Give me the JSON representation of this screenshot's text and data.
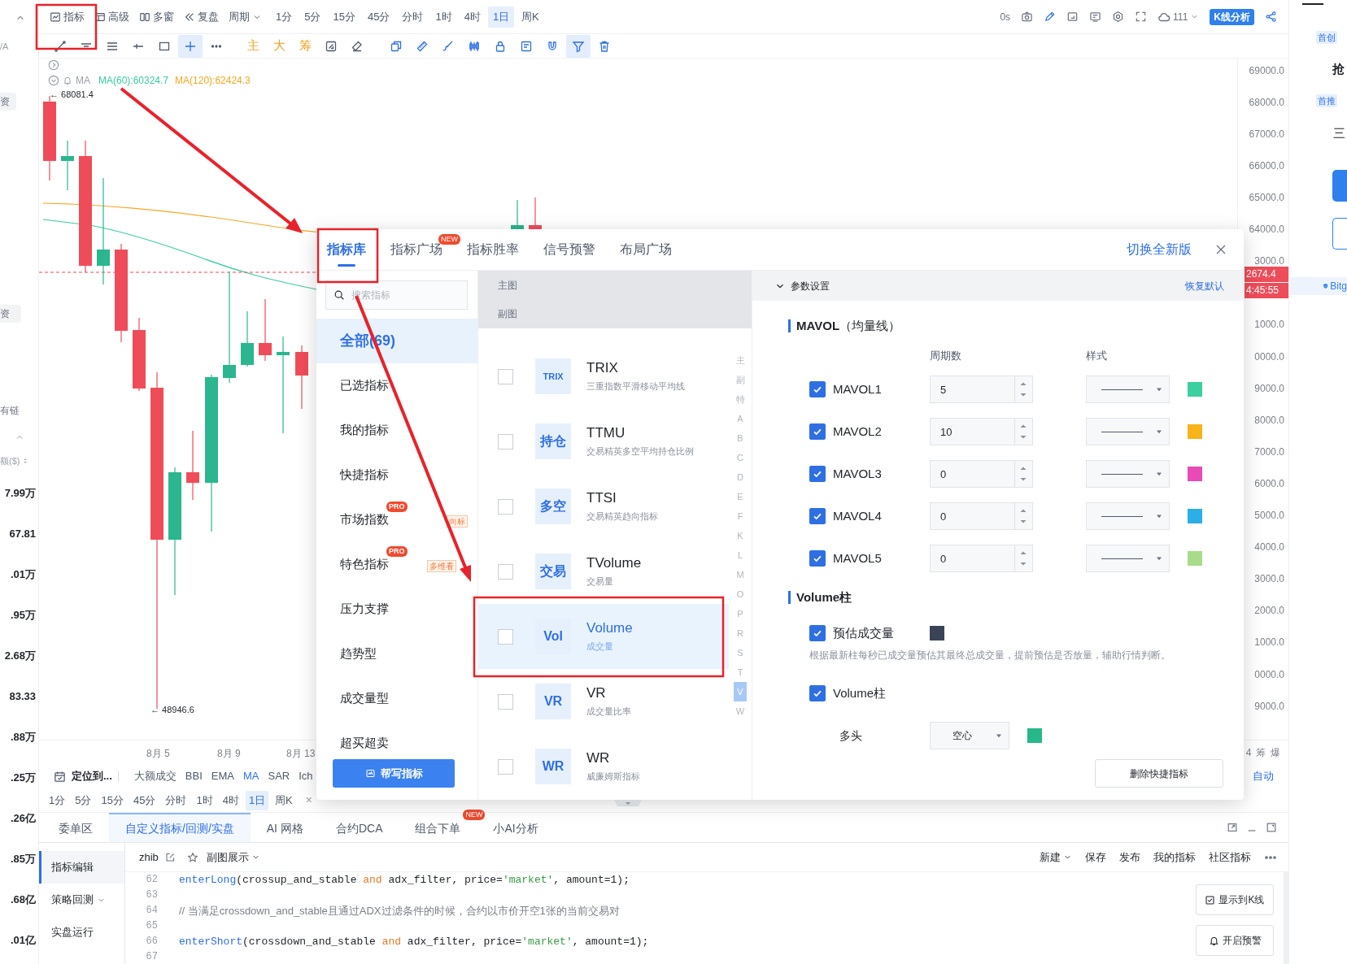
{
  "left_strip": {
    "label_a": "/A",
    "tag_1": "资",
    "tag_2": "资",
    "chain_label": "有链",
    "amount_header": "额($)",
    "values": [
      "7.99万",
      "67.81",
      ".01万",
      ".95万",
      "2.68万",
      "83.33",
      ".88万",
      ".25万",
      ".26亿",
      ".85万",
      ".68亿",
      ".01亿"
    ]
  },
  "toolbar": {
    "buttons": [
      {
        "kind": "indicator",
        "label": "指标"
      },
      {
        "kind": "advanced",
        "label": "高级"
      },
      {
        "kind": "multi",
        "label": "多窗"
      },
      {
        "kind": "replay",
        "label": "复盘"
      },
      {
        "kind": "period",
        "label": "周期"
      }
    ],
    "periods": [
      {
        "label": "1分",
        "selected": false
      },
      {
        "label": "5分",
        "selected": false
      },
      {
        "label": "15分",
        "selected": false
      },
      {
        "label": "45分",
        "selected": false
      },
      {
        "label": "分时",
        "selected": false
      },
      {
        "label": "1时",
        "selected": false
      },
      {
        "label": "4时",
        "selected": false
      },
      {
        "label": "1日",
        "selected": true
      },
      {
        "label": "周K",
        "selected": false
      }
    ],
    "latency": "0s",
    "cloud_count": "111",
    "analysis_button": "K线分析"
  },
  "drawing_tools": [
    {
      "kind": "trend",
      "selected": false
    },
    {
      "kind": "hline",
      "selected": false
    },
    {
      "kind": "lines",
      "selected": false
    },
    {
      "kind": "ray",
      "selected": false
    },
    {
      "kind": "rect",
      "selected": false
    },
    {
      "kind": "crosshair",
      "selected": true
    },
    {
      "kind": "more",
      "selected": false
    },
    {
      "kind": "char",
      "label": "主",
      "selected": false
    },
    {
      "kind": "char",
      "label": "大",
      "selected": false
    },
    {
      "kind": "char",
      "label": "筹",
      "selected": false
    },
    {
      "kind": "frame",
      "selected": false
    },
    {
      "kind": "eraser",
      "selected": false
    },
    {
      "kind": "copy",
      "selected": false
    },
    {
      "kind": "ruler",
      "selected": false
    },
    {
      "kind": "brush",
      "selected": false
    },
    {
      "kind": "candles",
      "selected": false
    },
    {
      "kind": "lock",
      "selected": false
    },
    {
      "kind": "note",
      "selected": false
    },
    {
      "kind": "magnet",
      "selected": false
    },
    {
      "kind": "filter",
      "selected": true
    },
    {
      "kind": "trash",
      "selected": false
    }
  ],
  "chart": {
    "ma_label": "MA",
    "ma60": "MA(60):60324.7",
    "ma120": "MA(120):62424.3",
    "high_label": "← 68081.4",
    "low_label": "← 48946.6",
    "price_axis": [
      "69000.0",
      "68000.0",
      "67000.0",
      "66000.0",
      "65000.0",
      "64000.0",
      "3000.0",
      "1000.0",
      "0000.0",
      "9000.0",
      "8000.0",
      "7000.0",
      "6000.0",
      "5000.0",
      "4000.0",
      "3000.0",
      "2000.0",
      "1000.0",
      "0000.0",
      "9000.0"
    ],
    "last_price": "2674.4",
    "countdown": "4:45:55",
    "x_labels": [
      "8月 5",
      "8月 9",
      "8月 13"
    ],
    "axis_footer": [
      "4",
      "筹",
      "爆"
    ],
    "scale_mode": "自动"
  },
  "indicator_bar": {
    "locate": "定位到...",
    "items": [
      {
        "label": "大额成交",
        "selected": false
      },
      {
        "label": "BBI",
        "selected": false
      },
      {
        "label": "EMA",
        "selected": false
      },
      {
        "label": "MA",
        "selected": true
      },
      {
        "label": "SAR",
        "selected": false
      },
      {
        "label": "Ich",
        "selected": false
      }
    ]
  },
  "period_bar": {
    "periods": [
      {
        "label": "1分",
        "selected": false
      },
      {
        "label": "5分",
        "selected": false
      },
      {
        "label": "15分",
        "selected": false
      },
      {
        "label": "45分",
        "selected": false
      },
      {
        "label": "分时",
        "selected": false
      },
      {
        "label": "1时",
        "selected": false
      },
      {
        "label": "4时",
        "selected": false
      },
      {
        "label": "1日",
        "selected": true
      },
      {
        "label": "周K",
        "selected": false
      }
    ],
    "close": "×"
  },
  "dialog": {
    "tabs": [
      {
        "label": "指标库",
        "selected": true
      },
      {
        "label": "指标广场",
        "selected": false,
        "badge": "NEW"
      },
      {
        "label": "指标胜率",
        "selected": false
      },
      {
        "label": "信号预警",
        "selected": false
      },
      {
        "label": "布局广场",
        "selected": false
      }
    ],
    "switch_link": "切换全新版",
    "search": {
      "placeholder": "搜索指标"
    },
    "categories": [
      {
        "label": "全部(69)",
        "selected": true
      },
      {
        "label": "已选指标",
        "selected": false
      },
      {
        "label": "我的指标",
        "selected": false
      },
      {
        "label": "快捷指标",
        "selected": false
      },
      {
        "label": "市场指数",
        "selected": false,
        "badge": "PRO",
        "tag": "向标"
      },
      {
        "label": "特色指标",
        "selected": false,
        "badge": "PRO",
        "tag": "多维看"
      },
      {
        "label": "压力支撑",
        "selected": false
      },
      {
        "label": "趋势型",
        "selected": false
      },
      {
        "label": "成交量型",
        "selected": false
      },
      {
        "label": "超买超卖",
        "selected": false
      }
    ],
    "help_button": "帮写指标",
    "groups": [
      "主图",
      "副图"
    ],
    "indicators": [
      {
        "icon_text": "TRIX",
        "name": "TRIX",
        "desc": "三重指数平滑移动平均线",
        "checked": false,
        "selected": false
      },
      {
        "icon_text": "持仓",
        "name": "TTMU",
        "desc": "交易精英多空平均持仓比例",
        "checked": false,
        "selected": false
      },
      {
        "icon_text": "多空",
        "name": "TTSI",
        "desc": "交易精英趋向指标",
        "checked": false,
        "selected": false
      },
      {
        "icon_text": "交易",
        "name": "TVolume",
        "desc": "交易量",
        "checked": false,
        "selected": false
      },
      {
        "icon_text": "Vol",
        "name": "Volume",
        "desc": "成交量",
        "checked": false,
        "selected": true
      },
      {
        "icon_text": "VR",
        "name": "VR",
        "desc": "成交量比率",
        "checked": false,
        "selected": false
      },
      {
        "icon_text": "WR",
        "name": "WR",
        "desc": "威廉姆斯指标",
        "checked": false,
        "selected": false
      }
    ],
    "index": [
      {
        "label": "主",
        "selected": false
      },
      {
        "label": "副",
        "selected": false
      },
      {
        "label": "特",
        "selected": false
      },
      {
        "label": "A",
        "selected": false
      },
      {
        "label": "B",
        "selected": false
      },
      {
        "label": "C",
        "selected": false
      },
      {
        "label": "D",
        "selected": false
      },
      {
        "label": "E",
        "selected": false
      },
      {
        "label": "F",
        "selected": false
      },
      {
        "label": "K",
        "selected": false
      },
      {
        "label": "L",
        "selected": false
      },
      {
        "label": "M",
        "selected": false
      },
      {
        "label": "O",
        "selected": false
      },
      {
        "label": "P",
        "selected": false
      },
      {
        "label": "R",
        "selected": false
      },
      {
        "label": "S",
        "selected": false
      },
      {
        "label": "T",
        "selected": false
      },
      {
        "label": "V",
        "selected": true
      },
      {
        "label": "W",
        "selected": false
      }
    ],
    "params": {
      "title": "参数设置",
      "reset": "恢复默认",
      "mavol_title": "**MAVOL**（均量线）",
      "columns": [
        "周期数",
        "样式"
      ],
      "lines": [
        {
          "name": "MAVOL1",
          "checked": true,
          "period": "5",
          "color": "#3ccf9f"
        },
        {
          "name": "MAVOL2",
          "checked": true,
          "period": "10",
          "color": "#f7b418"
        },
        {
          "name": "MAVOL3",
          "checked": true,
          "period": "0",
          "color": "#e84bb5"
        },
        {
          "name": "MAVOL4",
          "checked": true,
          "period": "0",
          "color": "#2eaee6"
        },
        {
          "name": "MAVOL5",
          "checked": true,
          "period": "0",
          "color": "#a8dc8a"
        }
      ],
      "volume_title": "Volume柱",
      "estimate": {
        "label": "预估成交量",
        "checked": true,
        "color": "#3b4457"
      },
      "estimate_desc": "根据最新柱每秒已成交量预估其最终总成交量，提前预估是否放量，辅助行情判断。",
      "volume_bar": {
        "label": "Volume柱",
        "checked": true
      },
      "bull": {
        "label": "多头",
        "style": "空心",
        "color": "#27b889"
      },
      "delete_button": "删除快捷指标"
    }
  },
  "bottom_panel": {
    "tabs": [
      {
        "label": "委单区",
        "selected": false
      },
      {
        "label": "自定义指标/回测/实盘",
        "selected": true
      },
      {
        "label": "AI 网格",
        "selected": false
      },
      {
        "label": "合约DCA",
        "selected": false
      },
      {
        "label": "组合下单",
        "selected": false,
        "badge": "NEW"
      },
      {
        "label": "小AI分析",
        "selected": false
      }
    ],
    "script_name": "zhib",
    "view_menu": "副图展示",
    "actions": [
      {
        "label": "新建",
        "dropdown": true
      },
      {
        "label": "保存",
        "dropdown": false
      },
      {
        "label": "发布",
        "dropdown": false
      },
      {
        "label": "我的指标",
        "dropdown": false
      },
      {
        "label": "社区指标",
        "dropdown": false
      }
    ],
    "sidebar": [
      {
        "label": "指标编辑",
        "selected": true,
        "dropdown": false
      },
      {
        "label": "策略回测",
        "selected": false,
        "dropdown": true
      },
      {
        "label": "实盘运行",
        "selected": false,
        "dropdown": false
      }
    ],
    "code": [
      {
        "number": "62",
        "segments": [
          {
            "kind": "fn",
            "text": "enterLong"
          },
          {
            "kind": "plain",
            "text": "(crossup_and_stable "
          },
          {
            "kind": "keyword",
            "text": "and"
          },
          {
            "kind": "plain",
            "text": " adx_filter, price="
          },
          {
            "kind": "string",
            "text": "'market'"
          },
          {
            "kind": "plain",
            "text": ", amount=1);"
          }
        ]
      },
      {
        "number": "63"
      },
      {
        "number": "64",
        "segments": [
          {
            "kind": "comment",
            "text": "// 当满足crossdown_and_stable且通过ADX过滤条件的时候，合约以市价开空1张的当前交易对"
          }
        ]
      },
      {
        "number": "65"
      },
      {
        "number": "66",
        "segments": [
          {
            "kind": "fn",
            "text": "enterShort"
          },
          {
            "kind": "plain",
            "text": "(crossdown_and_stable "
          },
          {
            "kind": "keyword",
            "text": "and"
          },
          {
            "kind": "plain",
            "text": " adx_filter, price="
          },
          {
            "kind": "string",
            "text": "'market'"
          },
          {
            "kind": "plain",
            "text": ", amount=1);"
          }
        ]
      },
      {
        "number": "67"
      }
    ],
    "buttons": [
      {
        "kind": "chart",
        "label": "显示到K线"
      },
      {
        "kind": "alert",
        "label": "开启预警"
      }
    ]
  },
  "right_panel": {
    "badge_1": "首创",
    "text_1": "抢",
    "badge_2": "首推",
    "text_2": "三",
    "link": "Bitg"
  }
}
